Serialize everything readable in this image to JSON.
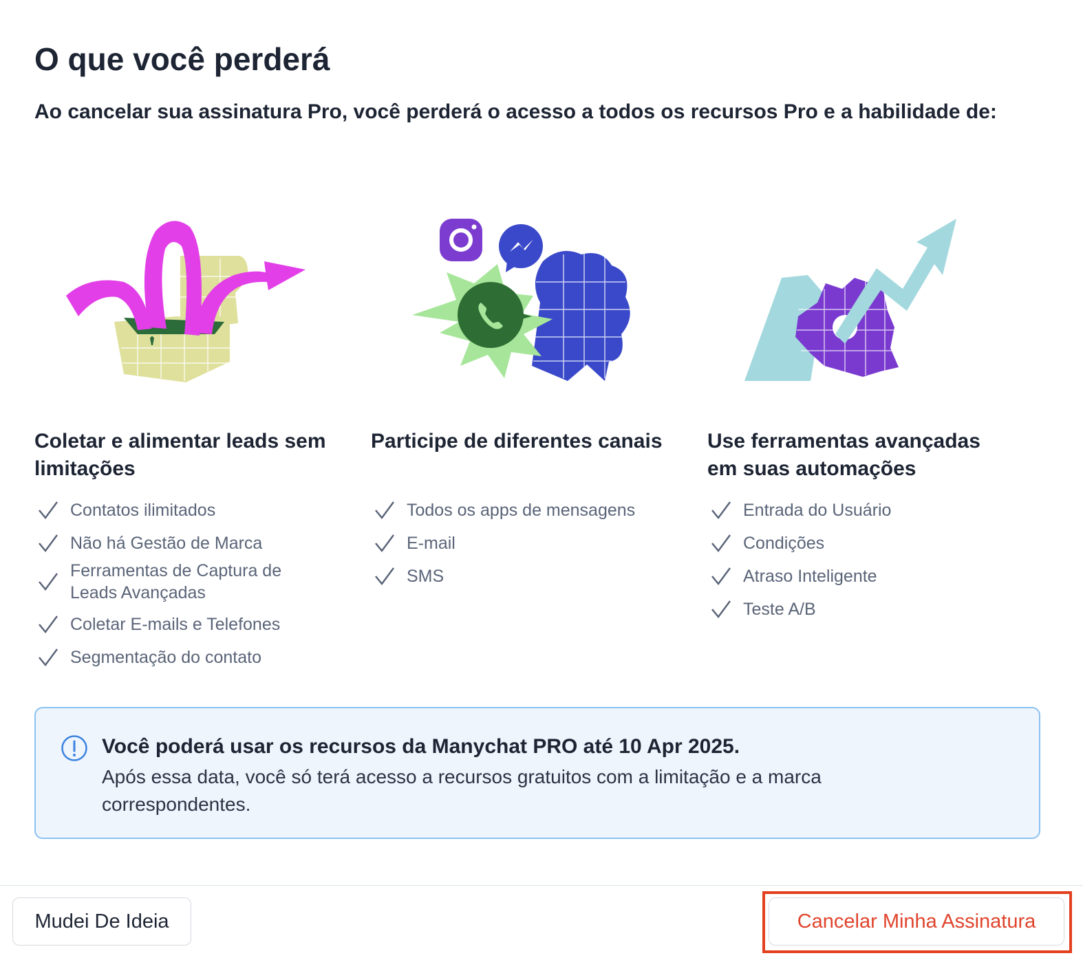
{
  "header": {
    "title": "O que você perderá",
    "subtitle": "Ao cancelar sua assinatura Pro, você perderá o acesso a todos os recursos Pro e a habilidade de:"
  },
  "columns": [
    {
      "title": "Coletar e alimentar leads sem limitações",
      "illustration_icon": "open-chest-illustration-icon",
      "items": [
        "Contatos ilimitados",
        "Não há Gestão de Marca",
        "Ferramentas de Captura de Leads Avançadas",
        "Coletar E-mails e Telefones",
        "Segmentação do contato"
      ]
    },
    {
      "title": "Participe de diferentes canais",
      "illustration_icon": "messaging-channels-illustration-icon",
      "items": [
        "Todos os apps de mensagens",
        "E-mail",
        "SMS"
      ]
    },
    {
      "title": "Use ferramentas avançadas em suas automações",
      "illustration_icon": "automation-growth-illustration-icon",
      "items": [
        "Entrada do Usuário",
        "Condições",
        "Atraso Inteligente",
        "Teste A/B"
      ]
    }
  ],
  "notice": {
    "icon": "info-icon",
    "title": "Você poderá usar os recursos da Manychat PRO até 10 Apr 2025.",
    "body": "Após essa data, você só terá acesso a recursos gratuitos com a limitação e a marca correspondentes."
  },
  "footer": {
    "secondary_label": "Mudei De Ideia",
    "cancel_label": "Cancelar Minha Assinatura"
  },
  "colors": {
    "text_primary": "#1d2433",
    "text_secondary": "#5a6478",
    "notice_bg": "#eef5fd",
    "notice_border": "#8cc1f0",
    "danger": "#e0442c",
    "highlight": "#e2401f"
  }
}
